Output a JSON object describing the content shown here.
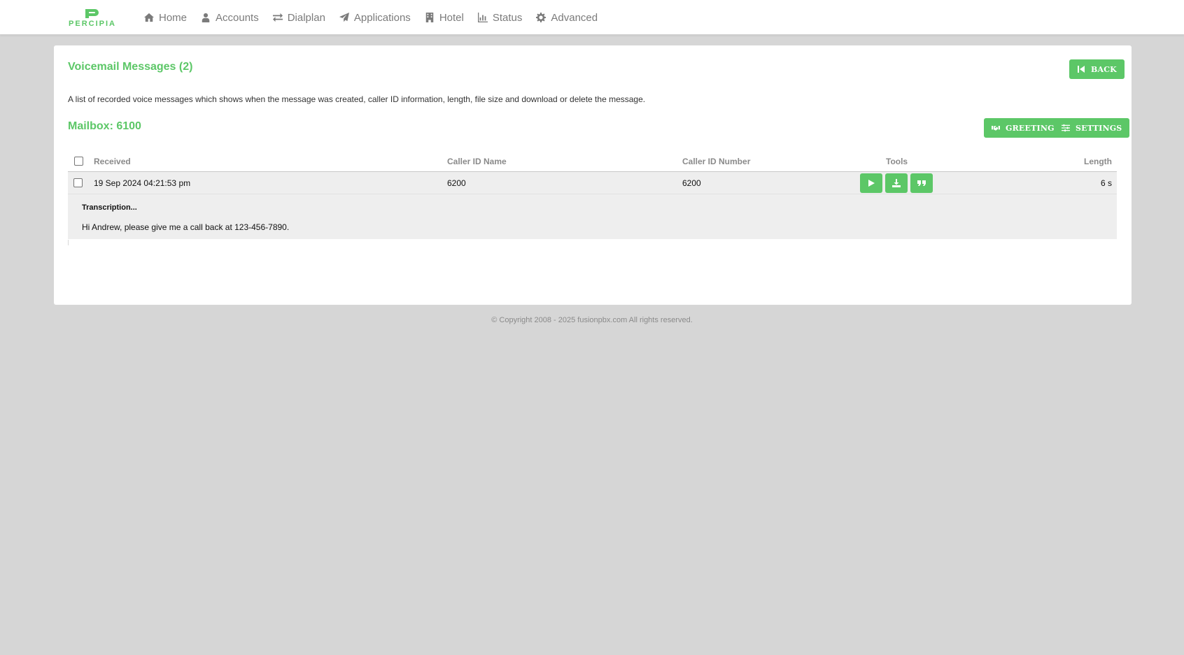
{
  "brand": {
    "name": "PERCIPIA",
    "accent": "#5cc767"
  },
  "nav": [
    {
      "label": "Home",
      "icon": "home-icon"
    },
    {
      "label": "Accounts",
      "icon": "user-icon"
    },
    {
      "label": "Dialplan",
      "icon": "exchange-icon"
    },
    {
      "label": "Applications",
      "icon": "paper-plane-icon"
    },
    {
      "label": "Hotel",
      "icon": "building-icon"
    },
    {
      "label": "Status",
      "icon": "chart-icon"
    },
    {
      "label": "Advanced",
      "icon": "gear-icon"
    }
  ],
  "page": {
    "title": "Voicemail Messages (2)",
    "description": "A list of recorded voice messages which shows when the message was created, caller ID information, length, file size and download or delete the message.",
    "mailbox_title": "Mailbox: 6100"
  },
  "buttons": {
    "back": "BACK",
    "greetings": "GREETINGS",
    "settings": "SETTINGS"
  },
  "table": {
    "columns": {
      "received": "Received",
      "caller_id_name": "Caller ID Name",
      "caller_id_number": "Caller ID Number",
      "tools": "Tools",
      "length": "Length"
    },
    "rows": [
      {
        "received": "19 Sep 2024 04:21:53 pm",
        "caller_id_name": "6200",
        "caller_id_number": "6200",
        "length": "6 s",
        "transcription_title": "Transcription...",
        "transcription": "Hi Andrew, please give me a call back at 123-456-7890."
      }
    ]
  },
  "footer": {
    "copyright": "© Copyright 2008 - 2025 fusionpbx.com All rights reserved."
  }
}
